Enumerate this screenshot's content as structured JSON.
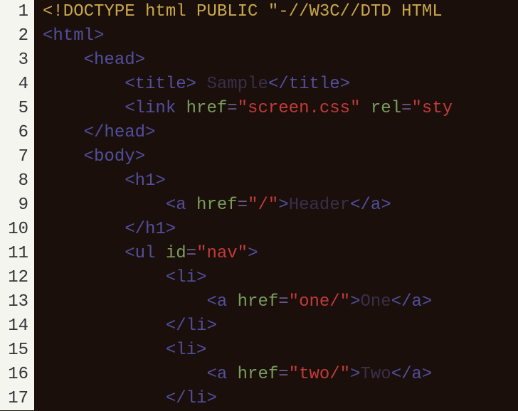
{
  "lines": [
    {
      "n": 1,
      "indent": 0,
      "tokens": [
        {
          "c": "doctype",
          "t": "<!DOCTYPE html PUBLIC \"-//W3C//DTD HTML"
        }
      ]
    },
    {
      "n": 2,
      "indent": 0,
      "tokens": [
        {
          "c": "tag",
          "t": "<html>"
        }
      ]
    },
    {
      "n": 3,
      "indent": 1,
      "tokens": [
        {
          "c": "tag",
          "t": "<head>"
        }
      ]
    },
    {
      "n": 4,
      "indent": 2,
      "tokens": [
        {
          "c": "tag",
          "t": "<title>"
        },
        {
          "c": "txt",
          "t": " Sample"
        },
        {
          "c": "tag",
          "t": "</title>"
        }
      ]
    },
    {
      "n": 5,
      "indent": 2,
      "tokens": [
        {
          "c": "tag",
          "t": "<link"
        },
        {
          "c": "",
          "t": " "
        },
        {
          "c": "attr",
          "t": "href"
        },
        {
          "c": "eq",
          "t": "="
        },
        {
          "c": "val",
          "t": "\"screen.css\""
        },
        {
          "c": "",
          "t": " "
        },
        {
          "c": "attr",
          "t": "rel"
        },
        {
          "c": "eq",
          "t": "="
        },
        {
          "c": "val",
          "t": "\"sty"
        }
      ]
    },
    {
      "n": 6,
      "indent": 1,
      "tokens": [
        {
          "c": "tag",
          "t": "</head>"
        }
      ]
    },
    {
      "n": 7,
      "indent": 1,
      "tokens": [
        {
          "c": "tag",
          "t": "<body>"
        }
      ]
    },
    {
      "n": 8,
      "indent": 2,
      "tokens": [
        {
          "c": "tag",
          "t": "<h1>"
        }
      ]
    },
    {
      "n": 9,
      "indent": 3,
      "tokens": [
        {
          "c": "tag",
          "t": "<a"
        },
        {
          "c": "",
          "t": " "
        },
        {
          "c": "attr",
          "t": "href"
        },
        {
          "c": "eq",
          "t": "="
        },
        {
          "c": "val",
          "t": "\"/\""
        },
        {
          "c": "tag",
          "t": ">"
        },
        {
          "c": "txt",
          "t": "Header"
        },
        {
          "c": "tag",
          "t": "</a>"
        }
      ]
    },
    {
      "n": 10,
      "indent": 2,
      "tokens": [
        {
          "c": "tag",
          "t": "</h1>"
        }
      ]
    },
    {
      "n": 11,
      "indent": 2,
      "tokens": [
        {
          "c": "tag",
          "t": "<ul"
        },
        {
          "c": "",
          "t": " "
        },
        {
          "c": "attr",
          "t": "id"
        },
        {
          "c": "eq",
          "t": "="
        },
        {
          "c": "val",
          "t": "\"nav\""
        },
        {
          "c": "tag",
          "t": ">"
        }
      ]
    },
    {
      "n": 12,
      "indent": 3,
      "tokens": [
        {
          "c": "tag",
          "t": "<li>"
        }
      ]
    },
    {
      "n": 13,
      "indent": 4,
      "tokens": [
        {
          "c": "tag",
          "t": "<a"
        },
        {
          "c": "",
          "t": " "
        },
        {
          "c": "attr",
          "t": "href"
        },
        {
          "c": "eq",
          "t": "="
        },
        {
          "c": "val",
          "t": "\"one/\""
        },
        {
          "c": "tag",
          "t": ">"
        },
        {
          "c": "txt",
          "t": "One"
        },
        {
          "c": "tag",
          "t": "</a>"
        }
      ]
    },
    {
      "n": 14,
      "indent": 3,
      "tokens": [
        {
          "c": "tag",
          "t": "</li>"
        }
      ]
    },
    {
      "n": 15,
      "indent": 3,
      "tokens": [
        {
          "c": "tag",
          "t": "<li>"
        }
      ]
    },
    {
      "n": 16,
      "indent": 4,
      "tokens": [
        {
          "c": "tag",
          "t": "<a"
        },
        {
          "c": "",
          "t": " "
        },
        {
          "c": "attr",
          "t": "href"
        },
        {
          "c": "eq",
          "t": "="
        },
        {
          "c": "val",
          "t": "\"two/\""
        },
        {
          "c": "tag",
          "t": ">"
        },
        {
          "c": "txt",
          "t": "Two"
        },
        {
          "c": "tag",
          "t": "</a>"
        }
      ]
    },
    {
      "n": 17,
      "indent": 3,
      "tokens": [
        {
          "c": "tag",
          "t": "</li>"
        }
      ]
    }
  ],
  "indent_unit": "    "
}
